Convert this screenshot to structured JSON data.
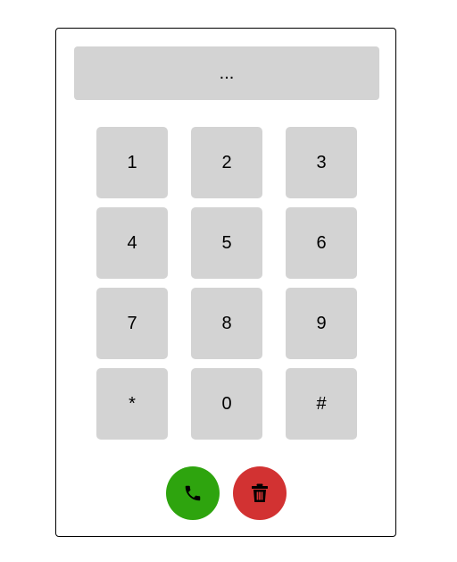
{
  "display": {
    "value": "..."
  },
  "keypad": {
    "keys": [
      "1",
      "2",
      "3",
      "4",
      "5",
      "6",
      "7",
      "8",
      "9",
      "*",
      "0",
      "#"
    ]
  },
  "actions": {
    "call_icon": "phone-icon",
    "delete_icon": "trash-icon"
  },
  "colors": {
    "call": "#2ea40e",
    "delete": "#d23232",
    "key_background": "#d3d3d3"
  }
}
